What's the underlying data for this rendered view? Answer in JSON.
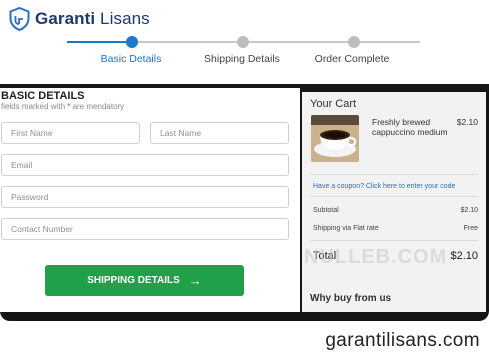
{
  "brand": {
    "name_bold": "Garanti",
    "name_light": " Lisans",
    "logo_icon": "shield-logo-icon"
  },
  "steps": [
    {
      "label": "Basic Details",
      "active": true
    },
    {
      "label": "Shipping Details",
      "active": false
    },
    {
      "label": "Order Complete",
      "active": false
    }
  ],
  "form": {
    "title": "BASIC DETAILS",
    "subtitle_before": "fields marked with ",
    "subtitle_star": "*",
    "subtitle_after": " are mendatory",
    "first_name_placeholder": "First Name",
    "last_name_placeholder": "Last Name",
    "email_placeholder": "Email",
    "password_placeholder": "Password",
    "contact_placeholder": "Contact Number",
    "submit_label": "SHIPPING DETAILS",
    "submit_icon": "arrow-right-icon"
  },
  "cart": {
    "title": "Your Cart",
    "product_name": "Freshly brewed cappuccino medium",
    "product_price": "$2.10",
    "coupon_link": "Have a coupon? Click here to enter your code",
    "subtotal_label": "Subtotal",
    "subtotal_value": "$2.10",
    "shipping_label": "Shipping via Flat rate",
    "shipping_value": "Free",
    "total_label": "Total",
    "total_value": "$2.10",
    "why_title": "Why buy from us"
  },
  "watermark": "NULLEB.COM",
  "footer_domain": "garantilisans.com",
  "colors": {
    "accent": "#1f77c9",
    "button": "#21a04a",
    "brand": "#1d3a6e"
  }
}
